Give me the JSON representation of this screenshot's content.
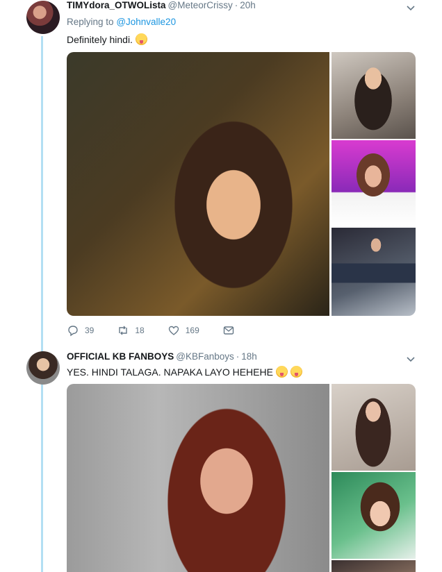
{
  "tweets": [
    {
      "name": "TIMYdora_OTWOLista",
      "handle": "@MeteorCrissy",
      "time": "20h",
      "replying_prefix": "Replying to",
      "replying_to": "@Johnvalle20",
      "text": "Definitely hindi.",
      "emojis": [
        "squinting-face-with-tongue"
      ],
      "stats": {
        "replies": "39",
        "retweets": "18",
        "likes": "169"
      }
    },
    {
      "name": "OFFICIAL KB FANBOYS",
      "handle": "@KBFanboys",
      "time": "18h",
      "text": "YES. HINDI TALAGA. NAPAKA LAYO HEHEHE",
      "emojis": [
        "squinting-face-with-tongue",
        "face-with-tears-of-joy"
      ]
    }
  ],
  "colors": {
    "link": "#1b95e0",
    "secondary_text": "#657786",
    "thread_line": "#b3dff3",
    "primary_text": "#14171a"
  },
  "icons": [
    "reply-icon",
    "retweet-icon",
    "like-icon",
    "direct-message-icon",
    "caret-down-icon"
  ]
}
